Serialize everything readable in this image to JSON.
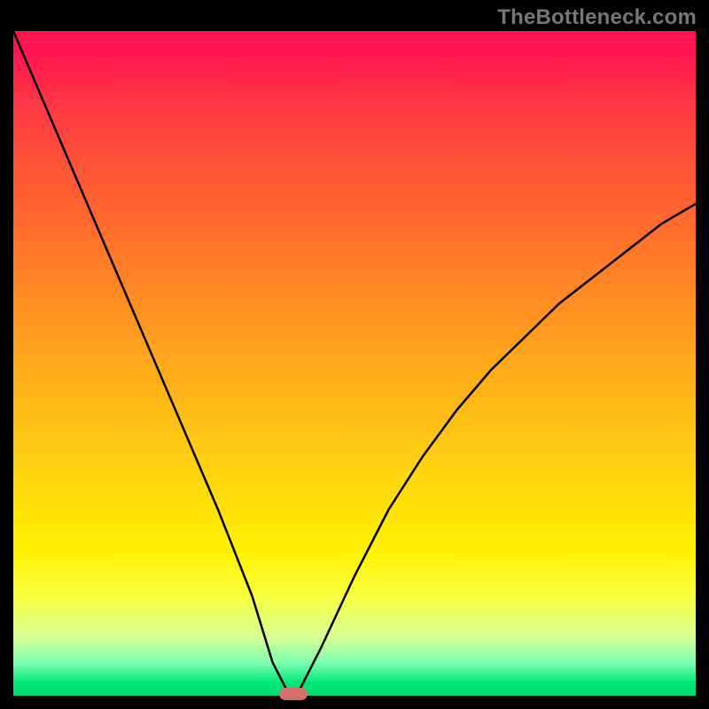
{
  "watermark": "TheBottleneck.com",
  "chart_data": {
    "type": "line",
    "title": "",
    "xlabel": "",
    "ylabel": "",
    "xlim": [
      0,
      100
    ],
    "ylim": [
      0,
      100
    ],
    "x": [
      0,
      5,
      10,
      15,
      20,
      25,
      30,
      35,
      38,
      40,
      41,
      42,
      45,
      50,
      55,
      60,
      65,
      70,
      75,
      80,
      85,
      90,
      95,
      100
    ],
    "values": [
      100,
      88,
      76,
      64,
      52,
      40,
      28,
      15,
      5,
      1,
      0,
      1,
      7,
      18,
      28,
      36,
      43,
      49,
      54,
      59,
      63,
      67,
      71,
      74
    ],
    "min_point": {
      "x": 41,
      "y": 0
    }
  },
  "colors": {
    "curve": "#000000",
    "marker": "#d6706e"
  }
}
